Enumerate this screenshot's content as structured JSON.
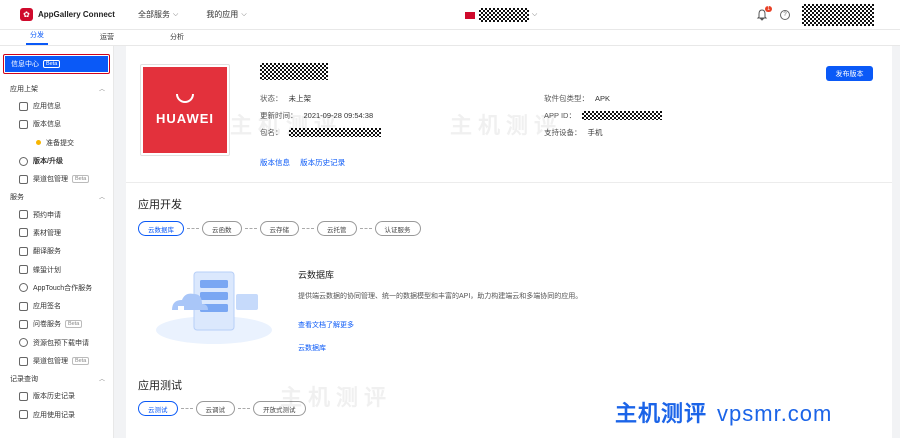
{
  "topbar": {
    "brand": "AppGallery Connect",
    "nav": [
      "全部服务",
      "我的应用"
    ],
    "notification_count": "1",
    "help_glyph": "?"
  },
  "subtabs": [
    "分发",
    "运营",
    "分析"
  ],
  "sidebar": {
    "active": {
      "label": "信息中心",
      "badge": "Beta"
    },
    "groups": [
      {
        "label": "应用上架",
        "items": [
          {
            "label": "应用信息",
            "icon": "app-info-icon"
          },
          {
            "label": "版本信息",
            "icon": "version-info-icon"
          },
          {
            "label": "准备提交",
            "icon": "pending-dot-icon",
            "sub": true
          },
          {
            "label": "版本/升级",
            "icon": "upgrade-icon",
            "bold": true
          },
          {
            "label": "渠道包管理",
            "icon": "channel-icon",
            "badge": "Beta"
          }
        ]
      },
      {
        "label": "服务",
        "items": [
          {
            "label": "预约申请",
            "icon": "reservation-icon"
          },
          {
            "label": "素材管理",
            "icon": "material-icon"
          },
          {
            "label": "翻译服务",
            "icon": "translate-icon"
          },
          {
            "label": "蝶蛩计划",
            "icon": "plan-icon"
          },
          {
            "label": "AppTouch合作服务",
            "icon": "apptouch-icon"
          },
          {
            "label": "应用签名",
            "icon": "signature-icon"
          },
          {
            "label": "问卷服务",
            "icon": "survey-icon",
            "badge": "Beta"
          },
          {
            "label": "资源包预下载申请",
            "icon": "download-icon"
          },
          {
            "label": "渠道包管理",
            "icon": "channel-icon",
            "badge": "Beta"
          }
        ]
      },
      {
        "label": "记录查询",
        "items": [
          {
            "label": "版本历史记录",
            "icon": "history-icon"
          },
          {
            "label": "应用使用记录",
            "icon": "usage-icon"
          }
        ]
      }
    ]
  },
  "app": {
    "status_label": "状态：",
    "status_value": "未上架",
    "updated_label": "更新时间：",
    "updated_value": "2021-09-28 09:54:38",
    "package_label": "包名：",
    "pkg_type_label": "软件包类型：",
    "pkg_type_value": "APK",
    "app_id_label": "APP ID：",
    "devices_label": "支持设备：",
    "devices_value": "手机",
    "links": [
      "版本信息",
      "版本历史记录"
    ],
    "publish_button": "发布版本",
    "icon_word": "HUAWEI"
  },
  "dev_section": {
    "title": "应用开发",
    "pills": [
      "云数据库",
      "云函数",
      "云存储",
      "云托管",
      "认证服务"
    ],
    "feature_title": "云数据库",
    "feature_desc": "提供端云数据的协同管理、统一的数据模型和丰富的API，助力构建端云和多端协同的应用。",
    "doc_link": "查看文档了解更多",
    "action_link": "云数据库"
  },
  "test_section": {
    "title": "应用测试",
    "pills": [
      "云测试",
      "云调试",
      "开放式测试"
    ]
  },
  "watermark": {
    "cn": "主机测评",
    "url": "vpsmr.com"
  },
  "colors": {
    "primary": "#0a59f7",
    "brand_red": "#cf0a2c",
    "highlight_border": "#d0021b"
  }
}
